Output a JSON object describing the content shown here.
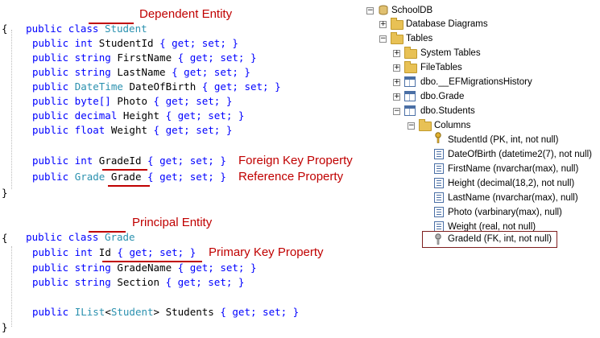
{
  "code": {
    "student": {
      "header_kw": "public class",
      "name": "Student",
      "annotation": "Dependent Entity",
      "open": "{",
      "close": "}",
      "props": [
        {
          "kw": "public int",
          "type": "",
          "name": "StudentId",
          "acc": "{ get; set; }"
        },
        {
          "kw": "public string",
          "type": "",
          "name": "FirstName",
          "acc": "{ get; set; }"
        },
        {
          "kw": "public string",
          "type": "",
          "name": "LastName",
          "acc": "{ get; set; }"
        },
        {
          "kw": "public",
          "type": "DateTime",
          "name": "DateOfBirth",
          "acc": "{ get; set; }"
        },
        {
          "kw": "public byte[]",
          "type": "",
          "name": "Photo",
          "acc": "{ get; set; }"
        },
        {
          "kw": "public decimal",
          "type": "",
          "name": "Height",
          "acc": "{ get; set; }"
        },
        {
          "kw": "public float",
          "type": "",
          "name": "Weight",
          "acc": "{ get; set; }"
        }
      ],
      "fk": {
        "kw": "public int",
        "name": "GradeId",
        "acc": "{ get; set; }",
        "annotation": "Foreign Key Property"
      },
      "ref": {
        "kw": "public",
        "type": "Grade",
        "name": "Grade",
        "acc": "{ get; set; }",
        "annotation": "Reference Property"
      }
    },
    "grade": {
      "header_kw": "public class",
      "name": "Grade",
      "annotation": "Principal Entity",
      "open": "{",
      "close": "}",
      "pk": {
        "kw": "public int",
        "name": "Id",
        "acc": "{ get; set; }",
        "annotation": "Primary Key Property"
      },
      "props": [
        {
          "kw": "public string",
          "name": "GradeName",
          "acc": "{ get; set; }"
        },
        {
          "kw": "public string",
          "name": "Section",
          "acc": "{ get; set; }"
        }
      ],
      "list": {
        "kw": "public",
        "type": "IList",
        "lt": "<",
        "gtype": "Student",
        "gt": ">",
        "name": "Students",
        "acc": "{ get; set; }"
      }
    }
  },
  "tree": {
    "database": "SchoolDB",
    "diagrams": "Database Diagrams",
    "tables": "Tables",
    "system_tables": "System Tables",
    "file_tables": "FileTables",
    "migrations": "dbo.__EFMigrationsHistory",
    "grade_table": "dbo.Grade",
    "students_table": "dbo.Students",
    "columns_folder": "Columns",
    "columns": [
      "StudentId (PK, int, not null)",
      "DateOfBirth (datetime2(7), not null)",
      "FirstName (nvarchar(max), null)",
      "Height (decimal(18,2), not null)",
      "LastName (nvarchar(max), null)",
      "Photo (varbinary(max), null)",
      "Weight (real, not null)",
      "GradeId (FK, int, not null)"
    ],
    "expand_plus": "+",
    "expand_minus": "−"
  },
  "colors": {
    "keyword": "#0000ff",
    "type": "#2b91af",
    "annotation": "#c00000",
    "highlight_border": "#7f1f1f"
  }
}
